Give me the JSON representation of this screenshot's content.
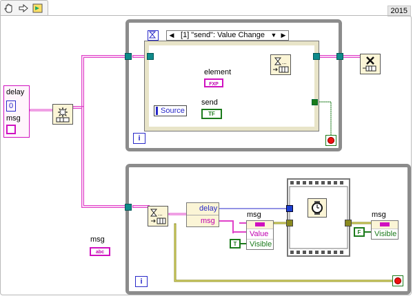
{
  "toolbar": {
    "year": "2015"
  },
  "controls": {
    "cluster_delay_label": "delay",
    "cluster_delay_value": "0",
    "cluster_msg_label": "msg",
    "msg_control_label": "msg",
    "msg_control_type": "abc"
  },
  "top_loop": {
    "event_case": "[1] \"send\": Value Change",
    "element_label": "element",
    "element_type": "FXP",
    "send_label": "send",
    "send_type": "TF",
    "source_label": "Source",
    "iteration": "i"
  },
  "bottom_loop": {
    "unbundle_delay": "delay",
    "unbundle_msg": "msg",
    "prop_node1_label": "msg",
    "prop_node1_rows": [
      "Value",
      "Visible"
    ],
    "true_const": "T",
    "prop_node2_label": "msg",
    "prop_node2_rows": [
      "Visible"
    ],
    "false_const": "F",
    "iteration": "i"
  },
  "colors": {
    "cluster_wire": "#e040c8",
    "ref_wire": "#0e8a8a",
    "bool_wire": "#1a7a1a",
    "error_wire": "#b8b000",
    "numeric_wire": "#2727c8",
    "loop_border": "#8c8c8c"
  }
}
